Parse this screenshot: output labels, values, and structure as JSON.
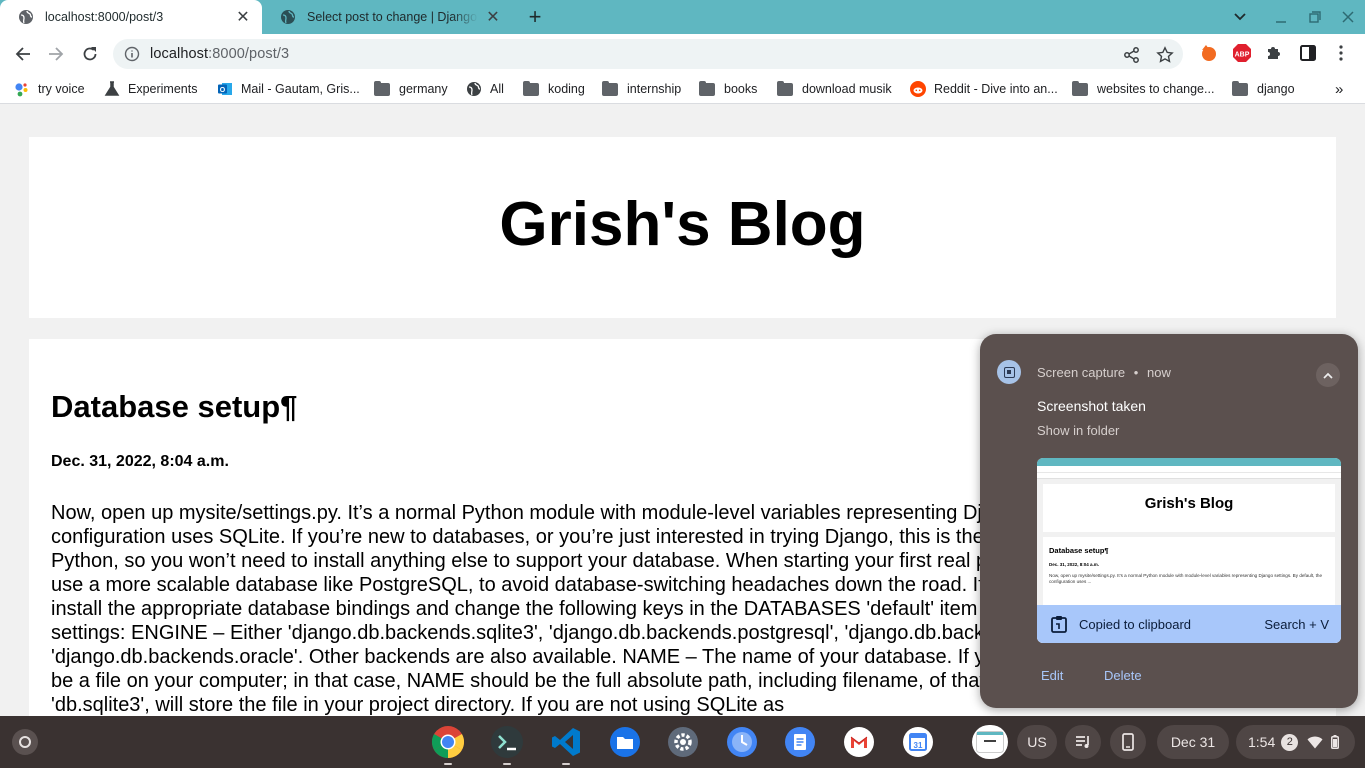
{
  "browser": {
    "tabs": [
      {
        "title": "localhost:8000/post/3",
        "active": true
      },
      {
        "title": "Select post to change | Django site admin",
        "active": false
      }
    ],
    "address": {
      "host": "localhost",
      "path": ":8000/post/3"
    },
    "bookmarks": [
      {
        "label": "try voice",
        "icon": "google-assistant-icon"
      },
      {
        "label": "Experiments",
        "icon": "flask-icon"
      },
      {
        "label": "Mail - Gautam, Gris...",
        "icon": "outlook-icon"
      },
      {
        "label": "germany",
        "icon": "folder-icon"
      },
      {
        "label": "All",
        "icon": "globe-icon"
      },
      {
        "label": "koding",
        "icon": "folder-icon"
      },
      {
        "label": "internship",
        "icon": "folder-icon"
      },
      {
        "label": "books",
        "icon": "folder-icon"
      },
      {
        "label": "download musik",
        "icon": "folder-icon"
      },
      {
        "label": "Reddit - Dive into an...",
        "icon": "reddit-icon"
      },
      {
        "label": "websites to change...",
        "icon": "folder-icon"
      },
      {
        "label": "django",
        "icon": "folder-icon"
      }
    ],
    "overflow": "»",
    "colors": {
      "tabstrip": "#5fb7c1",
      "accent": "#a8c7fa"
    }
  },
  "page": {
    "blog_title": "Grish's Blog",
    "post": {
      "title": "Database setup¶",
      "date": "Dec. 31, 2022, 8:04 a.m.",
      "body": "Now, open up mysite/settings.py. It’s a normal Python module with module-level variables representing Django settings. By default, the configuration uses SQLite. If you’re new to databases, or you’re just interested in trying Django, this is the easiest choice. SQLite is included in Python, so you won’t need to install anything else to support your database. When starting your first real project, however, you may want to use a more scalable database like PostgreSQL, to avoid database-switching headaches down the road. If you wish to use another database, install the appropriate database bindings and change the following keys in the DATABASES 'default' item to match your database connection settings: ENGINE – Either 'django.db.backends.sqlite3', 'django.db.backends.postgresql', 'django.db.backends.mysql', or 'django.db.backends.oracle'. Other backends are also available. NAME – The name of your database. If you’re using SQLite, the database will be a file on your computer; in that case, NAME should be the full absolute path, including filename, of that file. The default value, BASE_DIR / 'db.sqlite3', will store the file in your project directory. If you are not using SQLite as"
    }
  },
  "notification": {
    "app": "Screen capture",
    "sep": "•",
    "time": "now",
    "title": "Screenshot taken",
    "subtitle": "Show in folder",
    "thumb": {
      "blog_title": "Grish's Blog",
      "post_title": "Database setup¶",
      "post_date": "Dec. 31, 2022, 8:04 a.m.",
      "post_body": "Now, open up mysite/settings.py. It’s a normal Python module with module-level variables representing Django settings. By default, the configuration uses ..."
    },
    "clipboard": {
      "label": "Copied to clipboard",
      "shortcut": "Search + V"
    },
    "actions": {
      "edit": "Edit",
      "delete": "Delete"
    }
  },
  "shelf": {
    "apps": [
      "chrome-icon",
      "terminal-icon",
      "vscode-icon",
      "files-icon",
      "settings-icon",
      "clock-icon",
      "docs-icon",
      "gmail-icon",
      "calendar-icon"
    ],
    "calendar_day": "31",
    "ime": "US",
    "date": "Dec 31",
    "time": "1:54",
    "notification_count": "2"
  }
}
